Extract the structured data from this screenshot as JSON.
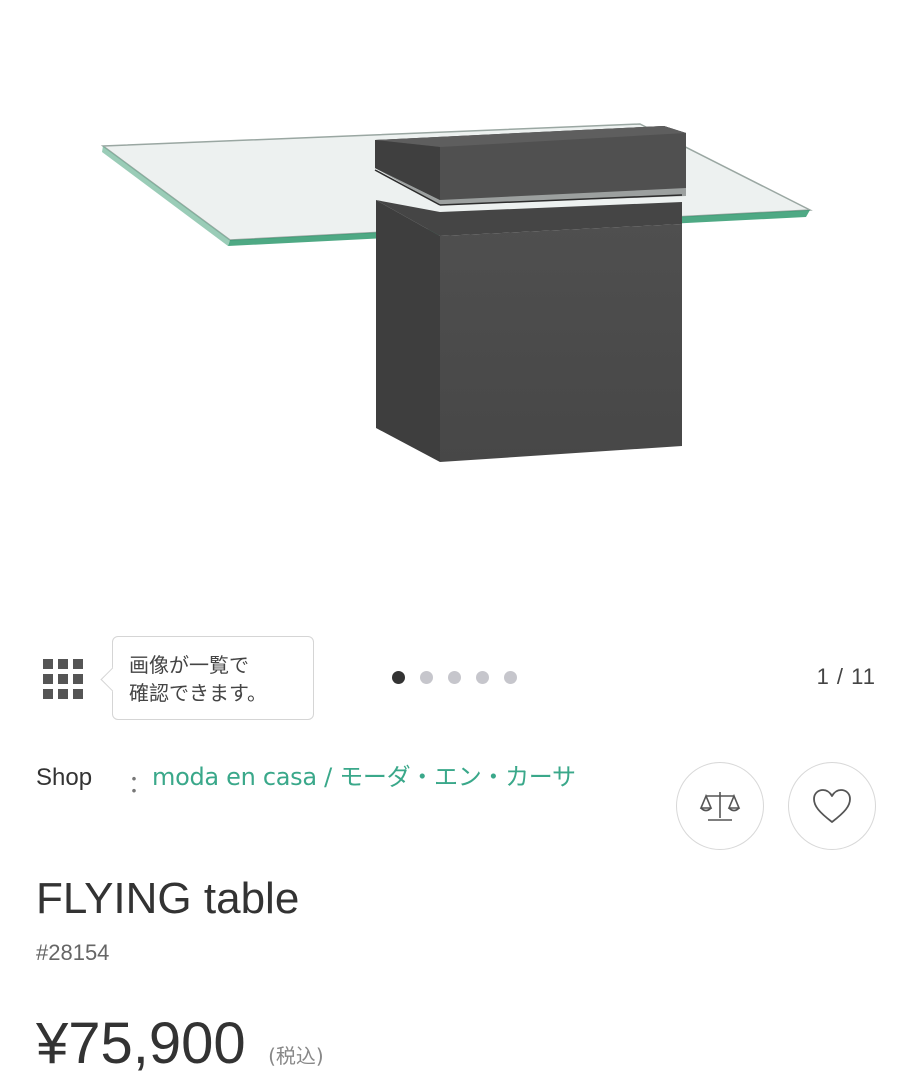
{
  "gallery": {
    "tooltip_line1": "画像が一覧で",
    "tooltip_line2": "確認できます。",
    "counter": "1 / 11",
    "dots_total": 5,
    "active_dot": 1
  },
  "product": {
    "shop_label": "Shop",
    "shop_colon": "：",
    "shop_name": "moda en casa / モーダ・エン・カーサ",
    "title": "FLYING table",
    "sku": "#28154",
    "price": "¥75,900",
    "tax_note": "(税込)"
  },
  "icons": {
    "grid": "grid-icon",
    "compare": "scale-icon",
    "favorite": "heart-icon"
  },
  "colors": {
    "link": "#3aa88a",
    "dot_active": "#333333",
    "dot_inactive": "#c6c6cc",
    "block": "#4a4a4a",
    "glass_edge": "#2f9a6e"
  }
}
